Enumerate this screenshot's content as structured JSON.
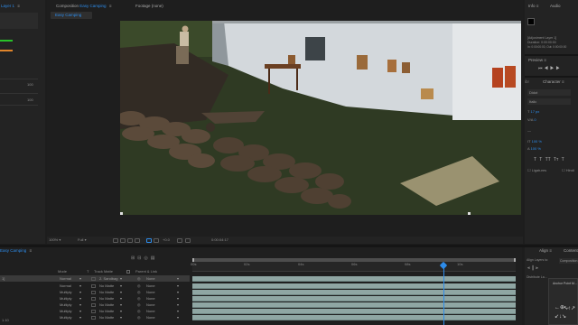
{
  "left_panel": {
    "layer_label": "Layer 1",
    "values": [
      "100",
      "100"
    ]
  },
  "composition": {
    "header_label": "Composition",
    "comp_name": "Easy Camping",
    "footage_label": "Footage (none)",
    "active_tab": "Easy Camping"
  },
  "viewer_toolbar": {
    "zoom": "100%",
    "resolution": "Full",
    "timecode": "0:00:04:17"
  },
  "right_panel": {
    "tabs": [
      "Info",
      "Audio"
    ],
    "info_lines": [
      "[Adjustment Layer 1]",
      "Duration: 0:00:00:00",
      "In: 0:00:00:00, Out: 0:00:00:00"
    ],
    "preview_label": "Preview",
    "character_label": "Character",
    "font_name": "Didot",
    "font_style": "Italic",
    "font_size": "17 px",
    "tracking": "0",
    "scale_v": "100 %",
    "scale_h": "100 %",
    "ligatures": "Ligatures",
    "hindi": "Hindi",
    "style_buttons": [
      "T",
      "T",
      "TT",
      "Tт",
      "T",
      "T"
    ]
  },
  "align_panel": {
    "tabs": [
      "Align",
      "Content"
    ],
    "align_to_label": "Align Layers to:",
    "align_to_value": "Composition",
    "distribute_label": "Distribute La...",
    "anchor_title": "Anchor Point M..."
  },
  "timeline": {
    "tab_label": "Easy Camping",
    "columns": {
      "mode": "Mode",
      "t": "T",
      "track_matte": "Track Matte",
      "parent": "Parent & Link"
    },
    "ruler": [
      "00s",
      "02s",
      "04s",
      "06s",
      "08s"
    ],
    "rows": [
      {
        "name": "1]",
        "mode": "Normal",
        "matte": "2. Sandbag",
        "parent": "None"
      },
      {
        "name": "",
        "mode": "Normal",
        "matte": "No Matte",
        "parent": "None"
      },
      {
        "name": "",
        "mode": "Multiply",
        "matte": "No Matte",
        "parent": "None"
      },
      {
        "name": "",
        "mode": "Multiply",
        "matte": "No Matte",
        "parent": "None"
      },
      {
        "name": "",
        "mode": "Multiply",
        "matte": "No Matte",
        "parent": "None"
      },
      {
        "name": "",
        "mode": "Multiply",
        "matte": "No Matte",
        "parent": "None"
      },
      {
        "name": "",
        "mode": "Multiply",
        "matte": "No Matte",
        "parent": "None"
      }
    ],
    "bottom_value": "1.10"
  },
  "colors": {
    "accent_blue": "#2d8ceb",
    "green_bar": "#29c229",
    "orange_bar": "#e0852b",
    "timeline_bar": "#8fa6a3",
    "playhead": "#2d8ceb"
  }
}
